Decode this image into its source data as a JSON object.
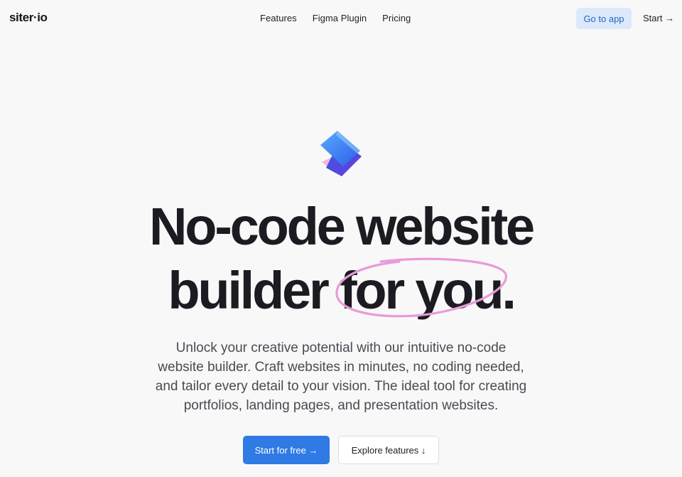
{
  "header": {
    "logo_left": "siter",
    "logo_dot": "·",
    "logo_right": "io",
    "nav": [
      {
        "label": "Features"
      },
      {
        "label": "Figma Plugin"
      },
      {
        "label": "Pricing"
      }
    ],
    "go_to_app_label": "Go to app",
    "start_label": "Start →"
  },
  "hero": {
    "mark_icon": "siter-stacked-cube-logo-icon",
    "headline_line1": "No-code website",
    "headline_line2_a": "builder ",
    "headline_line2_b": "for you.",
    "highlight_color": "#e99ad8",
    "description_lines": [
      "Unlock your creative potential with our intuitive no-code",
      "website builder. Craft websites in minutes, no coding needed,",
      "and tailor every detail to your vision. The ideal tool for creating",
      "portfolios, landing pages, and presentation websites."
    ],
    "primary_cta": "Start for free →",
    "secondary_cta": "Explore features ↓"
  },
  "colors": {
    "background": "#f8f8f9",
    "primary": "#2f7ae5",
    "app_button_bg": "#dce9fb"
  }
}
